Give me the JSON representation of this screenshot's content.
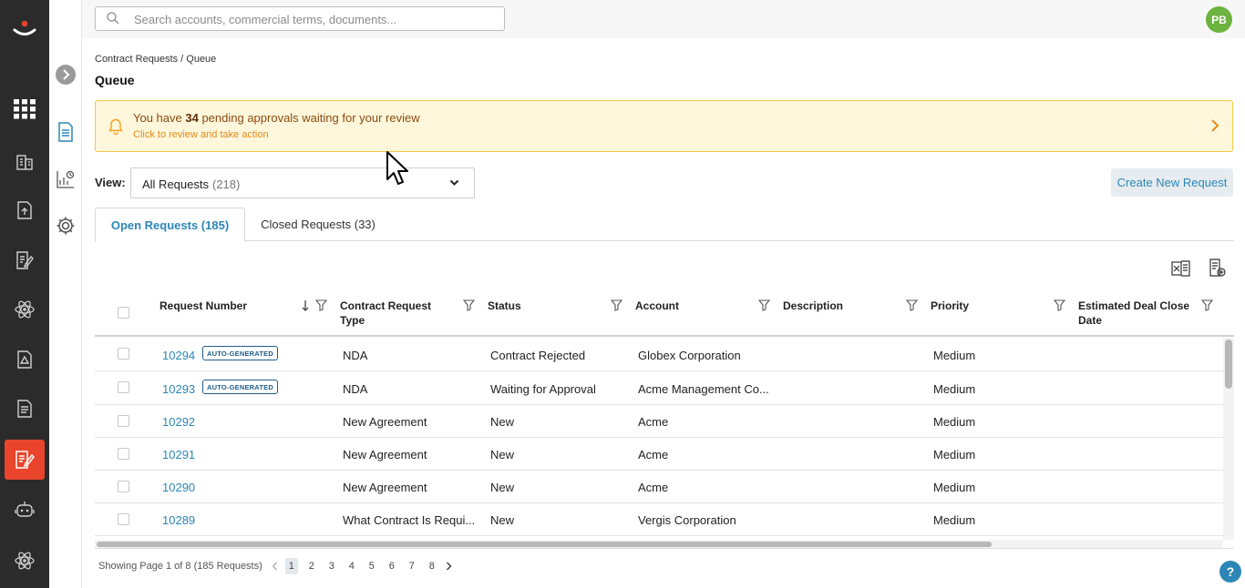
{
  "search": {
    "placeholder": "Search accounts, commercial terms, documents..."
  },
  "user": {
    "initials": "PB"
  },
  "breadcrumb": "Contract Requests / Queue",
  "page_title": "Queue",
  "banner": {
    "pre": "You have ",
    "count": "34",
    "post": " pending approvals waiting for your review",
    "sub": "Click to review and take action"
  },
  "view": {
    "label": "View:",
    "selected": "All Requests",
    "count": "(218)"
  },
  "create_button": "Create New Request",
  "tabs": [
    {
      "label": "Open Requests (185)"
    },
    {
      "label": "Closed Requests (33)"
    }
  ],
  "columns": [
    {
      "label": "Request Number"
    },
    {
      "label": "Contract Request Type"
    },
    {
      "label": "Status"
    },
    {
      "label": "Account"
    },
    {
      "label": "Description"
    },
    {
      "label": "Priority"
    },
    {
      "label": "Estimated Deal Close Date"
    }
  ],
  "rows": [
    {
      "number": "10294",
      "badge": "AUTO-GENERATED",
      "type": "NDA",
      "status": "Contract Rejected",
      "account": "Globex Corporation",
      "description": "",
      "priority": "Medium",
      "close_date": ""
    },
    {
      "number": "10293",
      "badge": "AUTO-GENERATED",
      "type": "NDA",
      "status": "Waiting for Approval",
      "account": "Acme Management Co...",
      "description": "",
      "priority": "Medium",
      "close_date": ""
    },
    {
      "number": "10292",
      "badge": "",
      "type": "New Agreement",
      "status": "New",
      "account": "Acme",
      "description": "",
      "priority": "Medium",
      "close_date": ""
    },
    {
      "number": "10291",
      "badge": "",
      "type": "New Agreement",
      "status": "New",
      "account": "Acme",
      "description": "",
      "priority": "Medium",
      "close_date": ""
    },
    {
      "number": "10290",
      "badge": "",
      "type": "New Agreement",
      "status": "New",
      "account": "Acme",
      "description": "",
      "priority": "Medium",
      "close_date": ""
    },
    {
      "number": "10289",
      "badge": "",
      "type": "What Contract Is Requi...",
      "status": "New",
      "account": "Vergis Corporation",
      "description": "",
      "priority": "Medium",
      "close_date": ""
    }
  ],
  "pagination": {
    "summary": "Showing Page 1 of 8 (185 Requests)",
    "pages": [
      "1",
      "2",
      "3",
      "4",
      "5",
      "6",
      "7",
      "8"
    ],
    "current": "1"
  },
  "help_label": "?",
  "colors": {
    "accent": "#2d86b5",
    "active_nav": "#e8452c",
    "rail": "#2b2b2b",
    "banner_bg": "#fff7db",
    "avatar": "#6cb33f"
  }
}
